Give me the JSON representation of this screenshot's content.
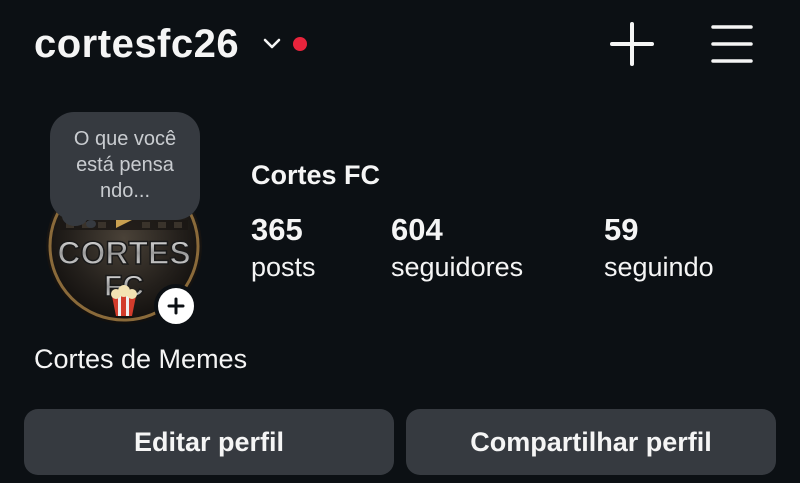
{
  "header": {
    "username": "cortesfc26",
    "notification_dot_color": "#e8243c",
    "chevron_icon": "chevron-down-icon",
    "create_icon": "plus-icon",
    "menu_icon": "hamburger-menu-icon"
  },
  "profile": {
    "display_name": "Cortes FC",
    "avatar_text_top": "CORTES",
    "avatar_text_bottom": "FC",
    "thought_bubble": {
      "line1": "O que você",
      "line2": "está pensa",
      "line3": "ndo..."
    },
    "stats": {
      "posts": {
        "count": "365",
        "label": "posts"
      },
      "followers": {
        "count": "604",
        "label": "seguidores"
      },
      "following": {
        "count": "59",
        "label": "seguindo"
      }
    },
    "bio": "Cortes de Memes"
  },
  "actions": {
    "edit_label": "Editar perfil",
    "share_label": "Compartilhar perfil"
  }
}
